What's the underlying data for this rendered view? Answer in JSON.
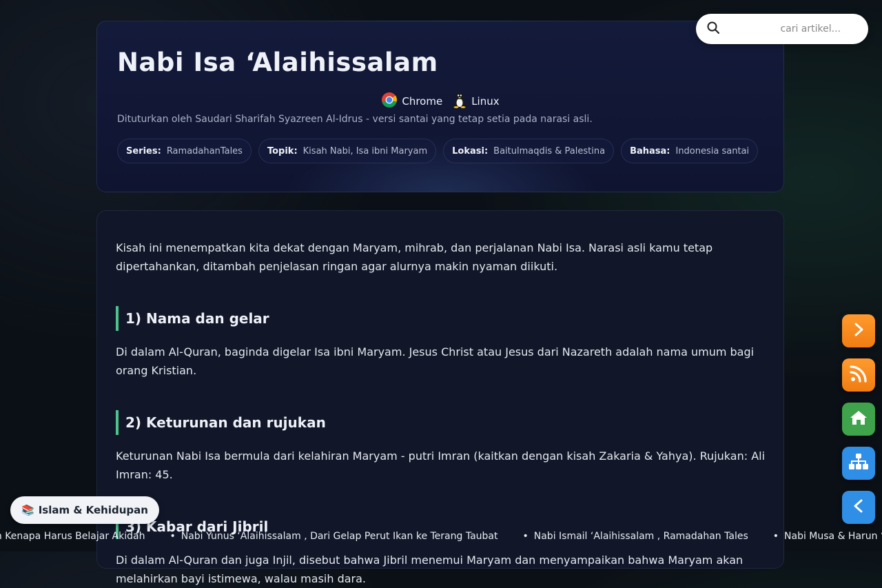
{
  "search": {
    "placeholder": "cari artikel..."
  },
  "header": {
    "title": "Nabi Isa ‘Alaihissalam",
    "badges": [
      {
        "icon": "chrome-icon",
        "label": "Chrome"
      },
      {
        "icon": "linux-tux-icon",
        "label": "Linux"
      }
    ],
    "subtitle": "Dituturkan oleh Saudari Sharifah Syazreen Al-Idrus - versi santai yang tetap setia pada narasi asli.",
    "meta": [
      {
        "key": "Series:",
        "value": "RamadahanTales"
      },
      {
        "key": "Topik:",
        "value": "Kisah Nabi, Isa ibni Maryam"
      },
      {
        "key": "Lokasi:",
        "value": "Baitulmaqdis & Palestina"
      },
      {
        "key": "Bahasa:",
        "value": "Indonesia santai"
      }
    ]
  },
  "content": {
    "intro": "Kisah ini menempatkan kita dekat dengan Maryam, mihrab, dan perjalanan Nabi Isa. Narasi asli kamu tetap dipertahankan, ditambah penjelasan ringan agar alurnya makin nyaman diikuti.",
    "sections": [
      {
        "heading": "1) Nama dan gelar",
        "body": "Di dalam Al-Quran, baginda digelar Isa ibni Maryam. Jesus Christ atau Jesus dari Nazareth adalah nama umum bagi orang Kristian."
      },
      {
        "heading": "2) Keturunan dan rujukan",
        "body": "Keturunan Nabi Isa bermula dari kelahiran Maryam - putri Imran (kaitkan dengan kisah Zakaria & Yahya). Rujukan: Ali Imran: 45."
      },
      {
        "heading": "3) Kabar dari Jibril",
        "body": "Di dalam Al-Quran dan juga Injil, disebut bahwa Jibril menemui Maryam dan menyampaikan bahwa Maryam akan melahirkan bayi istimewa, walau masih dara."
      }
    ]
  },
  "fabs": [
    {
      "name": "next-button",
      "icon": "chevron-right-icon",
      "color": "#f5891f"
    },
    {
      "name": "rss-button",
      "icon": "rss-icon",
      "color": "#f5891f"
    },
    {
      "name": "home-button",
      "icon": "home-icon",
      "color": "#3ea34a"
    },
    {
      "name": "sitemap-button",
      "icon": "sitemap-icon",
      "color": "#2f8ee6"
    },
    {
      "name": "back-button",
      "icon": "chevron-left-icon",
      "color": "#2f8ee6"
    }
  ],
  "category": {
    "icon": "books-icon",
    "emoji": "📚",
    "label": "Islam & Kehidupan"
  },
  "ticker": [
    "Alasan Kenapa Harus Belajar Akidah",
    "Nabi Yunus ‘Alaihissalam , Dari Gelap Perut Ikan ke Terang Taubat",
    "Nabi Ismail ‘Alaihissalam , Ramadahan Tales",
    "Nabi Musa & Harun ‘Alaihimassalam"
  ],
  "colors": {
    "accent": "#4fc38f",
    "card_bg": "#141a3a",
    "page_bg": "#0b1016"
  }
}
